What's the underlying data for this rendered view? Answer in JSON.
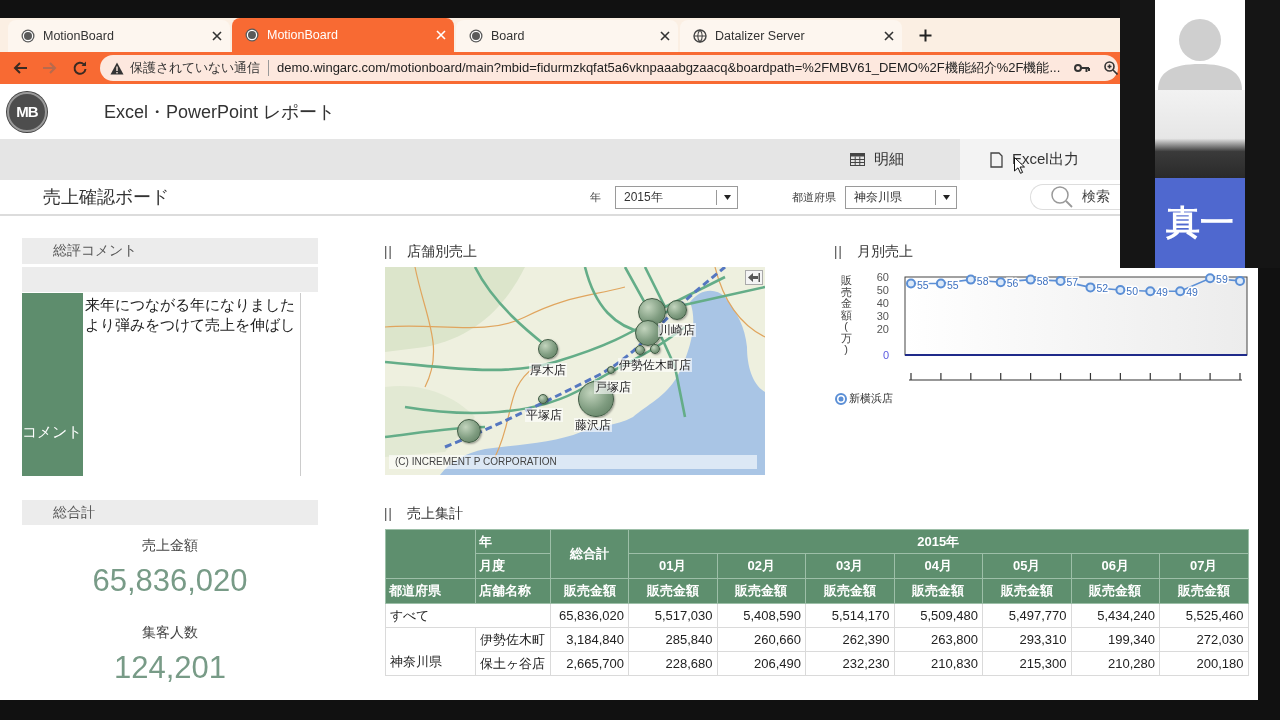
{
  "browser": {
    "tabs": [
      {
        "title": "MotionBoard",
        "kind": "logo",
        "selected": false
      },
      {
        "title": "MotionBoard",
        "kind": "logo",
        "selected": true
      },
      {
        "title": "Board",
        "kind": "logo",
        "selected": false
      },
      {
        "title": "Datalizer Server",
        "kind": "globe",
        "selected": false
      }
    ],
    "address_bar": {
      "security_warning": "保護されていない通信",
      "url": "demo.wingarc.com/motionboard/main?mbid=fidurmzkqfat5a6vknpaaabgzaacq&boardpath=%2FMBV61_DEMO%2F機能紹介%2F機能..."
    }
  },
  "app_header": {
    "logo": "MB",
    "title": "Excel・PowerPoint レポート"
  },
  "toolbar": [
    {
      "label": "明細",
      "kind": "table",
      "hovered": false
    },
    {
      "label": "Excel出力",
      "kind": "document",
      "hovered": true
    }
  ],
  "board": {
    "title": "売上確認ボード",
    "filters": [
      {
        "label": "年",
        "value": "2015年"
      },
      {
        "label": "都道府県",
        "value": "神奈川県"
      }
    ],
    "search_label": "検索"
  },
  "comment_panel": {
    "title": "総評コメント",
    "row_label": "コメント",
    "lines": [
      "来年につながる年になりました",
      "より弾みをつけて売上を伸ばし"
    ]
  },
  "totals_panel": {
    "title": "総合計",
    "metrics": [
      {
        "label": "売上金額",
        "value": "65,836,020"
      },
      {
        "label": "集客人数",
        "value": "124,201"
      }
    ]
  },
  "store_map": {
    "title": "店舗別売上",
    "markers": [
      {
        "label": "川崎店"
      },
      {
        "label": "伊勢佐木町店"
      },
      {
        "label": "厚木店"
      },
      {
        "label": "戸塚店"
      },
      {
        "label": "平塚店"
      },
      {
        "label": "藤沢店"
      }
    ],
    "attribution": "(C) INCREMENT P CORPORATION"
  },
  "monthly_chart": {
    "title": "月別売上",
    "chart_data": {
      "type": "line",
      "ylabel": "販売金額(万)",
      "ylim": [
        0,
        60
      ],
      "yticks": [
        0,
        20,
        30,
        40,
        50,
        60
      ],
      "series": [
        {
          "name": "新横浜店",
          "color": "#5b8fd6",
          "marker": "circle",
          "values": [
            55,
            55,
            58,
            56,
            58,
            57,
            52,
            50,
            49,
            49,
            59,
            57
          ]
        }
      ],
      "value_labels": [
        "55",
        "55",
        "58",
        "56",
        "58",
        "57",
        "52",
        "50",
        "49",
        "49",
        "59",
        null
      ]
    }
  },
  "sales_table": {
    "title": "売上集計",
    "year_header": "年",
    "month_header": "月度",
    "prefecture_header": "都道府県",
    "store_header": "店舗名称",
    "total_header": "総合計",
    "year": "2015年",
    "months": [
      "01月",
      "02月",
      "03月",
      "04月",
      "05月",
      "06月",
      "07月"
    ],
    "measure_headers": [
      "販売金額",
      "販売金額",
      "販売金額",
      "販売金額",
      "販売金額",
      "販売金額",
      "販売金額",
      "販売金額"
    ],
    "rows": [
      {
        "label": "すべて",
        "total": "65,836,020",
        "values": [
          "5,517,030",
          "5,408,590",
          "5,514,170",
          "5,509,480",
          "5,497,770",
          "5,434,240",
          "5,525,460"
        ]
      }
    ],
    "groups": [
      {
        "prefecture": "神奈川県",
        "stores": [
          {
            "name": "伊勢佐木町",
            "total": "3,184,840",
            "values": [
              "285,840",
              "260,660",
              "262,390",
              "263,800",
              "293,310",
              "199,340",
              "272,030"
            ]
          },
          {
            "name": "保土ヶ谷店",
            "total": "2,665,700",
            "values": [
              "228,680",
              "206,490",
              "232,230",
              "210,830",
              "215,300",
              "210,280",
              "200,180"
            ]
          }
        ]
      }
    ]
  },
  "video_tiles": [
    {
      "kind": "avatar"
    },
    {
      "kind": "camera"
    },
    {
      "kind": "name",
      "name": "真一"
    }
  ]
}
